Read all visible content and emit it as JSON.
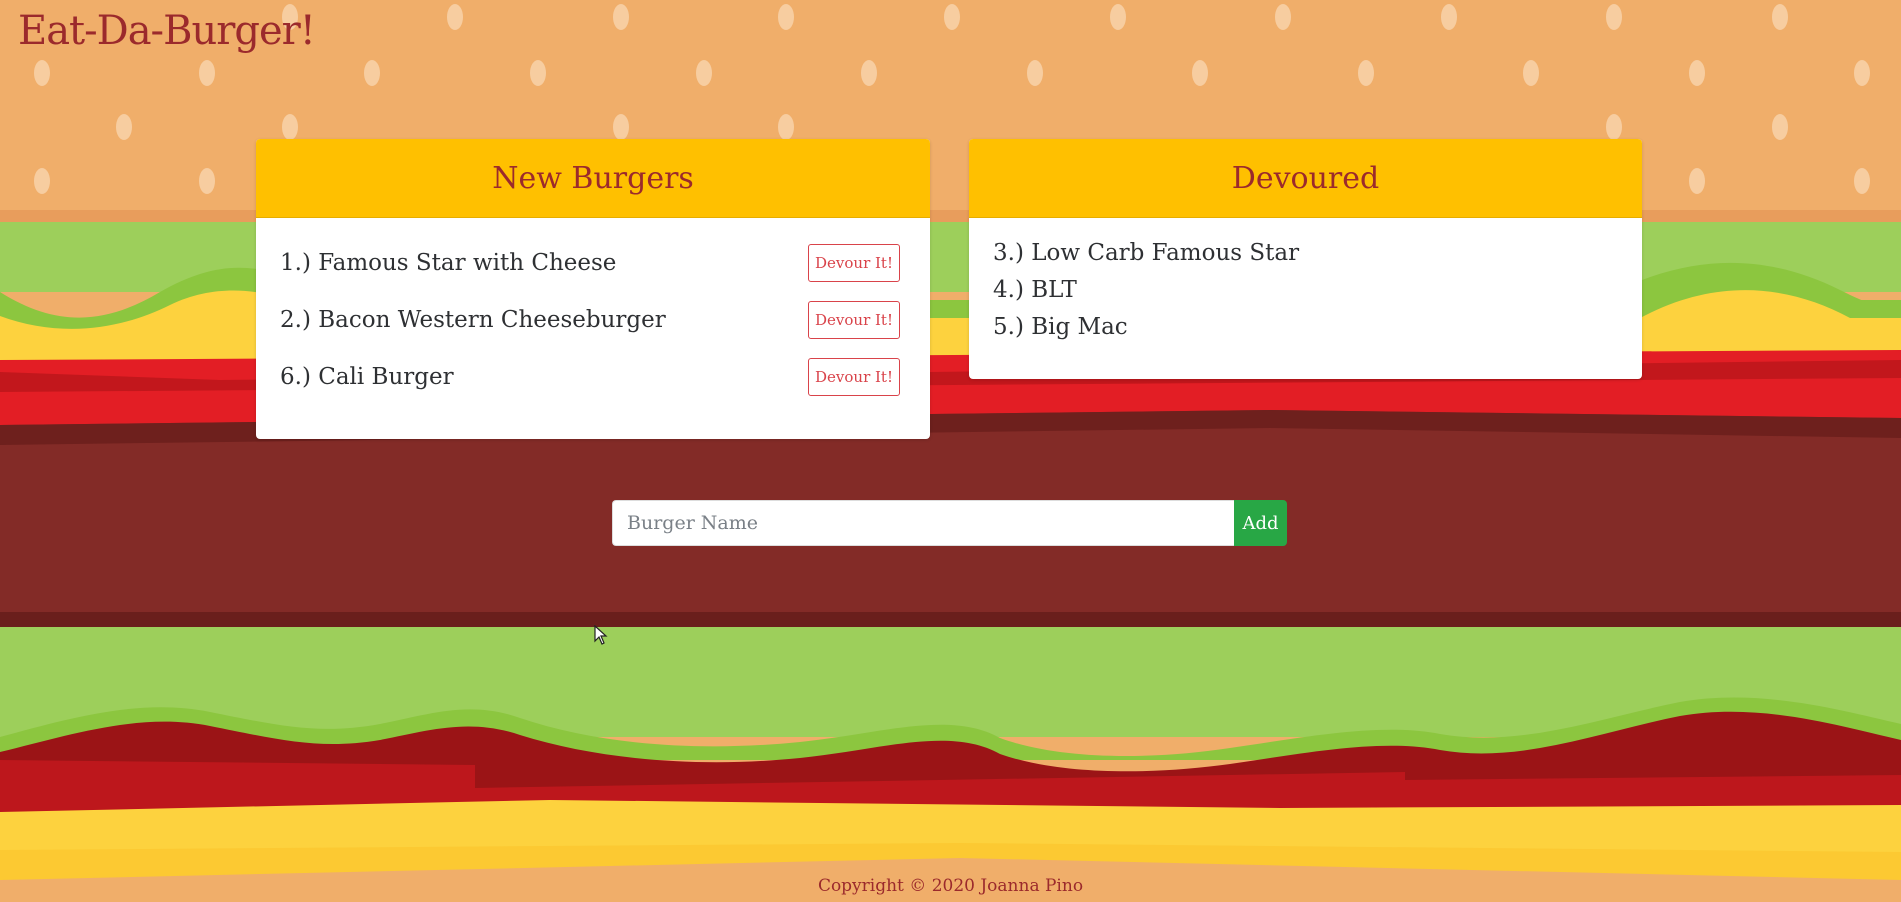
{
  "site": {
    "title": "Eat-Da-Burger!"
  },
  "new_burgers": {
    "heading": "New Burgers",
    "items": [
      {
        "text": "1.) Famous Star with Cheese",
        "button": "Devour It!"
      },
      {
        "text": "2.) Bacon Western Cheeseburger",
        "button": "Devour It!"
      },
      {
        "text": "6.) Cali Burger",
        "button": "Devour It!"
      }
    ]
  },
  "devoured": {
    "heading": "Devoured",
    "items": [
      {
        "text": "3.) Low Carb Famous Star"
      },
      {
        "text": "4.) BLT"
      },
      {
        "text": "5.) Big Mac"
      }
    ]
  },
  "form": {
    "placeholder": "Burger Name",
    "add_label": "Add"
  },
  "footer": {
    "text": "Copyright © 2020 Joanna Pino"
  },
  "colors": {
    "bun": "#f0ae6a",
    "seed": "#f7cda0",
    "lettuce": "#9dcf5b",
    "cheese": "#fdd23e",
    "tomato": "#e31e25",
    "patty": "#832b27",
    "header_yellow": "#ffc000",
    "title_red": "#9b2a2c",
    "add_green": "#28a745"
  }
}
